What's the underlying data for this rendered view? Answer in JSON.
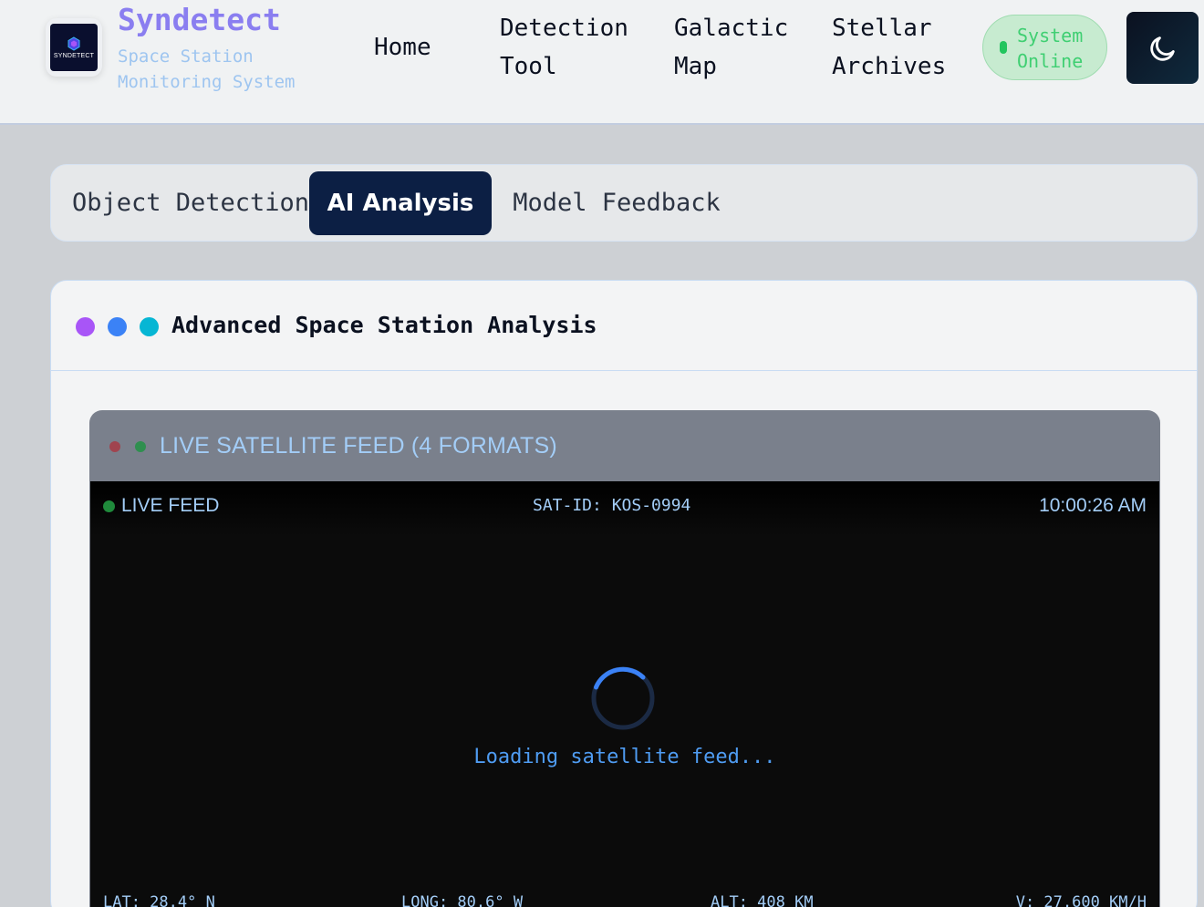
{
  "brand": {
    "logo_text": "SYNDETECT",
    "title": "Syndetect",
    "subtitle": "Space Station Monitoring System"
  },
  "nav": {
    "home": "Home",
    "detection_tool_line1": "Detection",
    "detection_tool_line2": "Tool",
    "galactic_map_line1": "Galactic",
    "galactic_map_line2": "Map",
    "stellar_archives_line1": "Stellar",
    "stellar_archives_line2": "Archives"
  },
  "status": {
    "line1": "System",
    "line2": "Online",
    "color": "#22c55e"
  },
  "theme_toggle": {
    "icon": "moon-icon"
  },
  "tabs": [
    {
      "label": "Object Detection",
      "active": false
    },
    {
      "label": "AI Analysis",
      "active": true
    },
    {
      "label": "Model Feedback",
      "active": false
    }
  ],
  "panel": {
    "title": "Advanced Space Station Analysis",
    "dot_colors": [
      "#a855f7",
      "#3b82f6",
      "#06b6d4"
    ]
  },
  "feed": {
    "title": "LIVE SATELLITE FEED (4 FORMATS)",
    "live_label": "LIVE FEED",
    "sat_id": "SAT-ID: KOS-0994",
    "time": "10:00:26 AM",
    "loading": "Loading satellite feed...",
    "lat": "LAT: 28.4° N",
    "long": "LONG: 80.6° W",
    "alt": "ALT: 408 KM",
    "velocity": "V: 27,600 KM/H"
  }
}
